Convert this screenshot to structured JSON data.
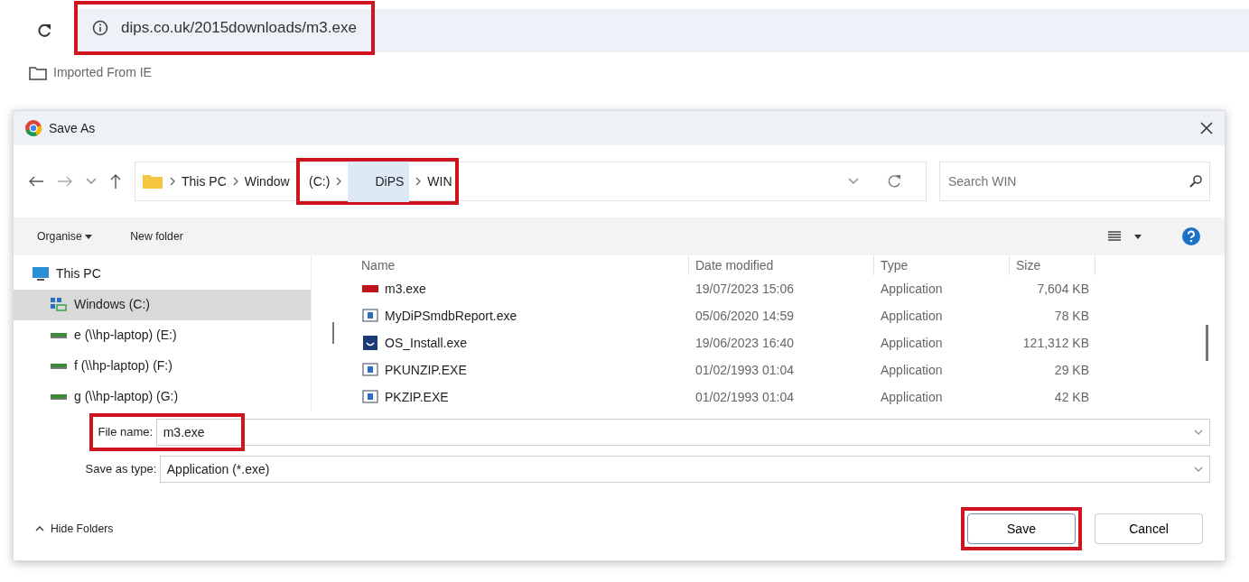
{
  "browser": {
    "address": "dips.co.uk/2015downloads/m3.exe",
    "bookmarks": [
      "Imported From IE"
    ]
  },
  "dialog": {
    "title": "Save As",
    "breadcrumb": [
      "This PC",
      "Window",
      "(C:)",
      "DiPS",
      "WIN"
    ],
    "search": {
      "placeholder": "Search WIN"
    },
    "commands": [
      "Organise",
      "New folder"
    ],
    "tree": [
      {
        "label": "This PC",
        "selected": false
      },
      {
        "label": "Windows (C:)",
        "selected": true
      },
      {
        "label": "e (\\\\hp-laptop) (E:)",
        "selected": false
      },
      {
        "label": "f (\\\\hp-laptop) (F:)",
        "selected": false
      },
      {
        "label": "g (\\\\hp-laptop) (G:)",
        "selected": false
      }
    ],
    "table": {
      "columns": [
        "Name",
        "Date modified",
        "Type",
        "Size"
      ],
      "rows": [
        {
          "name": "m3.exe",
          "date": "19/07/2023 15:06",
          "type": "Application",
          "size": "7,604 KB"
        },
        {
          "name": "MyDiPSmdbReport.exe",
          "date": "05/06/2020 14:59",
          "type": "Application",
          "size": "78 KB"
        },
        {
          "name": "OS_Install.exe",
          "date": "19/06/2023 16:40",
          "type": "Application",
          "size": "121,312 KB"
        },
        {
          "name": "PKUNZIP.EXE",
          "date": "01/02/1993 01:04",
          "type": "Application",
          "size": "29 KB"
        },
        {
          "name": "PKZIP.EXE",
          "date": "01/02/1993 01:04",
          "type": "Application",
          "size": "42 KB"
        }
      ]
    },
    "file_name": {
      "label": "File name:",
      "value": "m3.exe"
    },
    "save_as_type": {
      "label": "Save as type:",
      "value": "Application (*.exe)"
    },
    "hide_folders": "Hide Folders",
    "buttons": [
      "Save",
      "Cancel"
    ]
  }
}
